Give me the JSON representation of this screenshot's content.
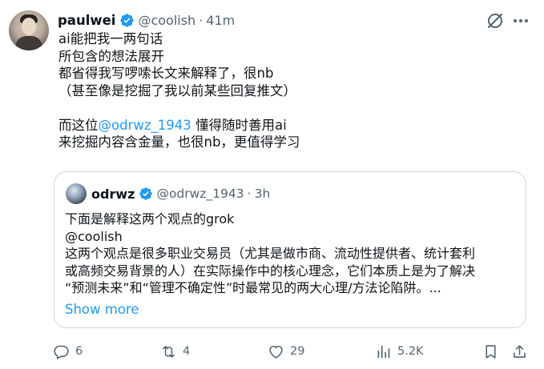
{
  "author": {
    "name": "paulwei",
    "handle": "@coolish",
    "separator": "·",
    "time": "41m"
  },
  "tweet": {
    "lines": [
      "ai能把我一两句话",
      "所包含的想法展开",
      "都省得我写啰嗦长文来解释了，很nb",
      "（甚至像是挖掘了我以前某些回复推文）",
      "",
      "而这位",
      "来挖掘内容含金量，也很nb，更值得学习"
    ],
    "mention": "@odrwz_1943",
    "line6_suffix": " 懂得随时善用ai"
  },
  "quote": {
    "name": "odrwz",
    "handle": "@odrwz_1943",
    "separator": "·",
    "time": "3h",
    "lines": [
      "下面是解释这两个观点的grok",
      "@coolish",
      "这两个观点是很多职业交易员（尤其是做市商、流动性提供者、统计套利",
      "或高频交易背景的人）在实际操作中的核心理念，它们本质上是为了解决",
      "“预测未来”和“管理不确定性”时最常见的两大心理/方法论陷阱。..."
    ],
    "show_more": "Show more"
  },
  "actions": {
    "replies": "6",
    "reposts": "4",
    "likes": "29",
    "views": "5.2K"
  },
  "colors": {
    "text": "#0f1419",
    "secondary": "#536471",
    "link": "#1d9bf0",
    "verified": "#1d9bf0",
    "border": "#cfd9de"
  }
}
